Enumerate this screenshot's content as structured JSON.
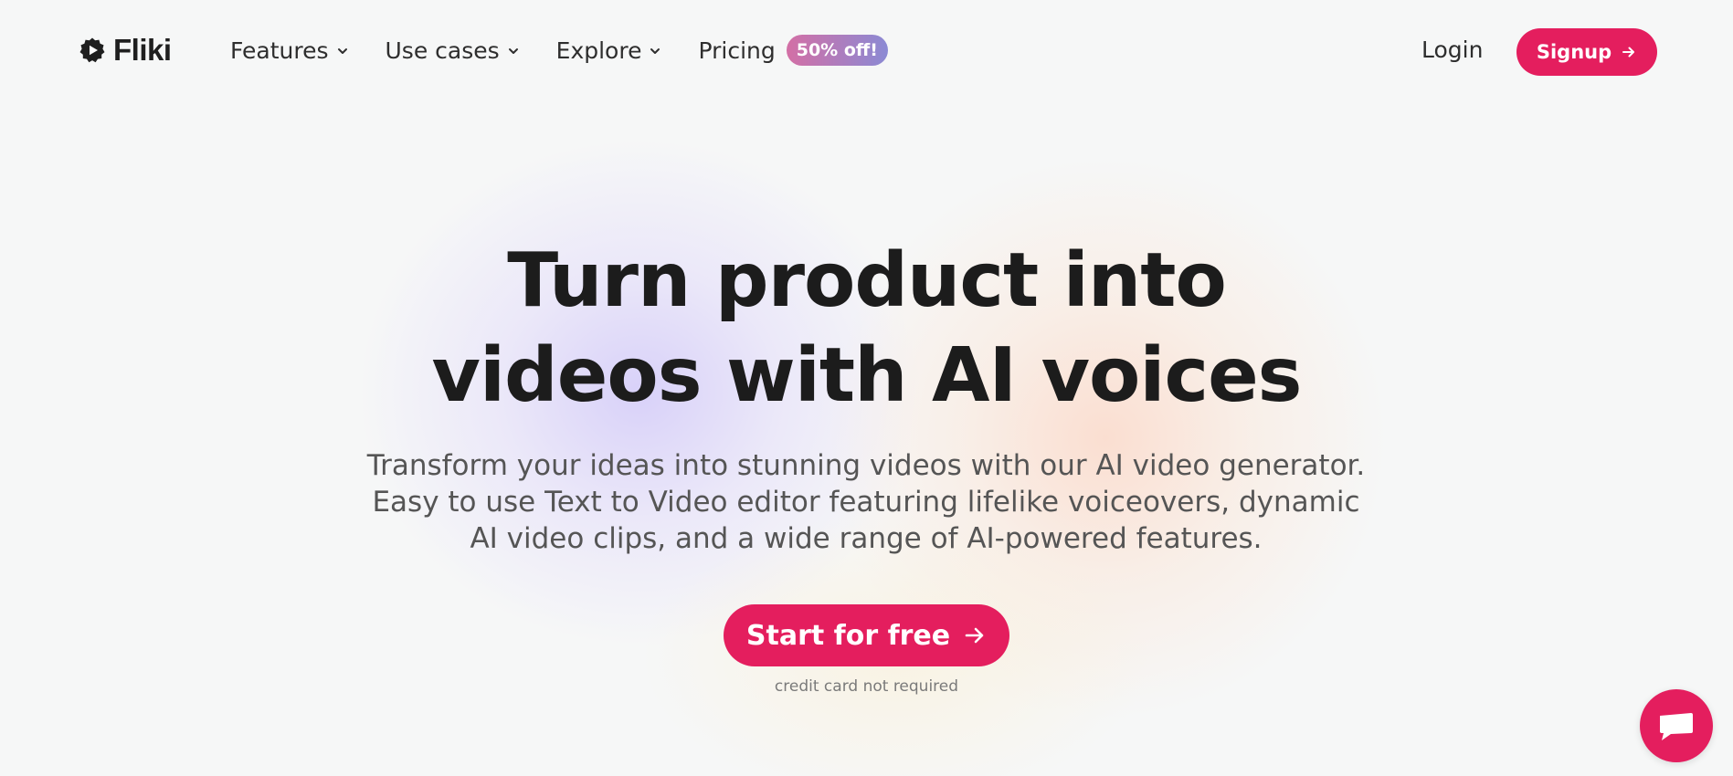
{
  "header": {
    "logo_text": "Fliki",
    "nav": [
      {
        "label": "Features",
        "has_dropdown": true
      },
      {
        "label": "Use cases",
        "has_dropdown": true
      },
      {
        "label": "Explore",
        "has_dropdown": true
      }
    ],
    "pricing_label": "Pricing",
    "pricing_badge": "50% off!",
    "login_label": "Login",
    "signup_label": "Signup"
  },
  "hero": {
    "title_line1": "Turn product into",
    "title_line2": "videos with AI voices",
    "subtitle": "Transform your ideas into stunning videos with our AI video generator. Easy to use Text to Video editor featuring lifelike voiceovers, dynamic AI video clips, and a wide range of AI-powered features.",
    "cta_label": "Start for free",
    "cta_note": "credit card not required"
  },
  "icons": {
    "logo": "play-gear-icon",
    "nav_dropdown": "chevron-down-icon",
    "arrow": "arrow-right-icon",
    "chat": "chat-icon"
  },
  "colors": {
    "accent": "#e41e5e",
    "badge_gradient_start": "#d36fa5",
    "badge_gradient_end": "#8b8ad4",
    "background": "#f6f7f7",
    "text_primary": "#1c1c1c",
    "text_secondary": "#555555"
  }
}
